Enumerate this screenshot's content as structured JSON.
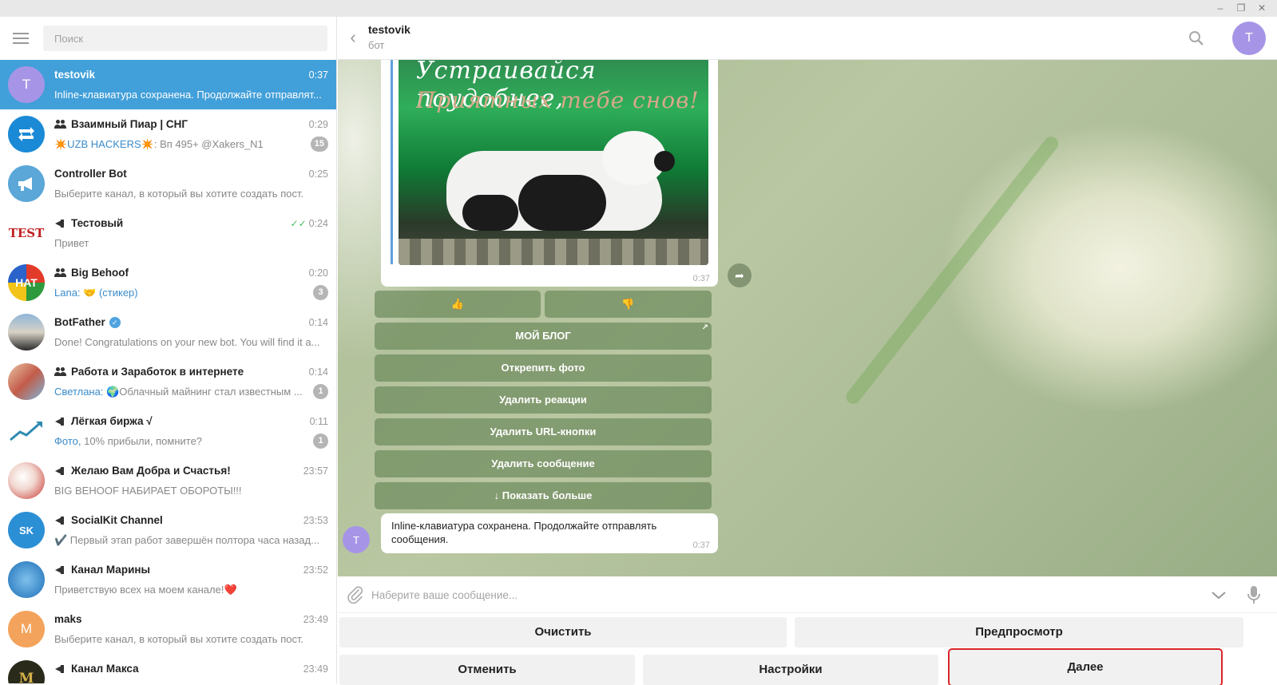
{
  "sidebar": {
    "search_placeholder": "Поиск",
    "chats": [
      {
        "name": "testovik",
        "time": "0:37",
        "message": "Inline-клавиатура сохранена. Продолжайте отправлят...",
        "avatar_letter": "T"
      },
      {
        "name": "Взаимный Пиар | СНГ",
        "time": "0:29",
        "sender": "✴️UZB HACKERS✴️",
        "message": ": Вп   495+ @Xakers_N1",
        "badge": "15"
      },
      {
        "name": "Controller Bot",
        "time": "0:25",
        "message": "Выберите канал, в который вы хотите создать пост."
      },
      {
        "name": "Тестовый",
        "time": "0:24",
        "message": "Привет",
        "avatar_text": "TEST"
      },
      {
        "name": "Big Behoof",
        "time": "0:20",
        "sender": "Lana: 🤝 (стикер)",
        "message": "",
        "badge": "3",
        "avatar_text": "HAT"
      },
      {
        "name": "BotFather",
        "time": "0:14",
        "message": "Done! Congratulations on your new bot. You will find it a..."
      },
      {
        "name": "Работа и Заработок в интернете",
        "time": "0:14",
        "sender": "Светлана:",
        "message": " 🌍Облачный майнинг стал известным ...",
        "badge": "1"
      },
      {
        "name": "Лёгкая биржа √",
        "time": "0:11",
        "sender": "Фото,",
        "message": " 10% прибыли, помните?",
        "badge": "1"
      },
      {
        "name": "Желаю Вам Добра и Счастья!",
        "time": "23:57",
        "message": "BIG BEHOOF НАБИРАЕТ ОБОРОТЫ!!!"
      },
      {
        "name": "SocialKit Channel",
        "time": "23:53",
        "message": "✔️ Первый этап работ завершён полтора часа назад...",
        "avatar_text": "SK"
      },
      {
        "name": "Канал Марины",
        "time": "23:52",
        "message": "Приветствую всех на моем канале!❤️"
      },
      {
        "name": "maks",
        "time": "23:49",
        "message": "Выберите канал, в который вы хотите создать пост.",
        "avatar_letter": "M"
      },
      {
        "name": "Канал Макса",
        "time": "23:49",
        "message": "",
        "avatar_letter": "M"
      }
    ]
  },
  "header": {
    "title": "testovik",
    "subtitle": "бот",
    "avatar_letter": "T"
  },
  "photo": {
    "line1": "Устраивайся поудобнее,",
    "line2": "Приятных тебе снов!",
    "time": "0:37"
  },
  "inline_keyboard": {
    "like": "👍",
    "dislike": "👎",
    "blog": "МОЙ БЛОГ",
    "unpin_photo": "Открепить фото",
    "delete_reactions": "Удалить реакции",
    "delete_url_buttons": "Удалить URL-кнопки",
    "delete_message": "Удалить сообщение",
    "show_more": "↓ Показать больше"
  },
  "last_message": {
    "text": "Inline-клавиатура сохранена. Продолжайте отправлять сообщения.",
    "time": "0:37",
    "avatar_letter": "T"
  },
  "composer": {
    "placeholder": "Наберите ваше сообщение..."
  },
  "reply_keyboard": {
    "clear": "Очистить",
    "preview": "Предпросмотр",
    "cancel": "Отменить",
    "settings": "Настройки",
    "next": "Далее"
  }
}
